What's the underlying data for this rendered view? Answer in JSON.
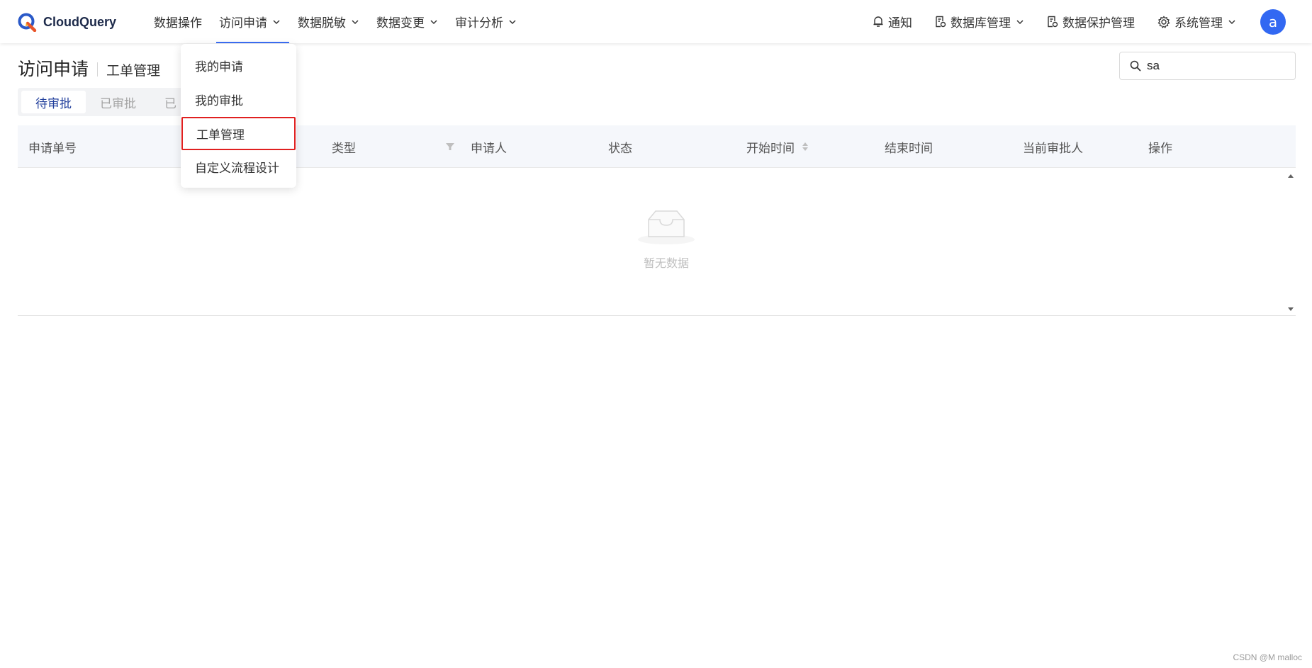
{
  "brand": {
    "name": "CloudQuery"
  },
  "nav": {
    "items": [
      {
        "label": "数据操作",
        "has_dropdown": false
      },
      {
        "label": "访问申请",
        "has_dropdown": true,
        "active": true
      },
      {
        "label": "数据脱敏",
        "has_dropdown": true
      },
      {
        "label": "数据变更",
        "has_dropdown": true
      },
      {
        "label": "审计分析",
        "has_dropdown": true
      }
    ],
    "right": {
      "notify": "通知",
      "db_manage": "数据库管理",
      "data_protect": "数据保护管理",
      "system_manage": "系统管理",
      "avatar_letter": "a"
    }
  },
  "dropdown": {
    "items": [
      "我的申请",
      "我的审批",
      "工单管理",
      "自定义流程设计"
    ],
    "selected_index": 2
  },
  "page": {
    "title": "访问申请",
    "subtitle": "工单管理"
  },
  "search": {
    "value": "sa"
  },
  "tabs": [
    "待审批",
    "已审批",
    "已"
  ],
  "table": {
    "columns": [
      "申请单号",
      "类型",
      "申请人",
      "状态",
      "开始时间",
      "结束时间",
      "当前审批人",
      "操作"
    ],
    "rows": [],
    "empty_text": "暂无数据"
  },
  "watermark": "CSDN @M malloc",
  "colors": {
    "accent": "#3b6ef5",
    "avatar": "#3268f2",
    "highlight_border": "#e02020"
  }
}
